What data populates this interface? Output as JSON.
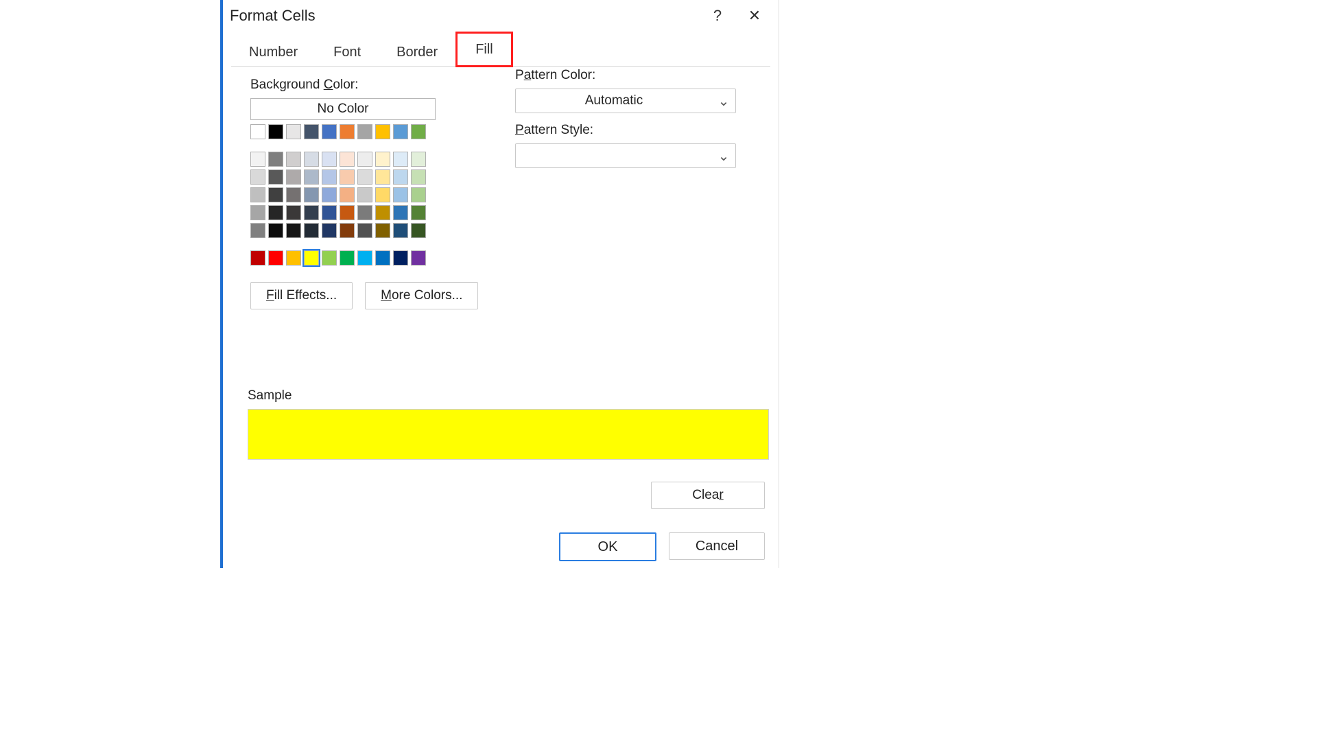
{
  "dialog": {
    "title": "Format Cells",
    "help_glyph": "?",
    "close_glyph": "✕"
  },
  "tabs": {
    "number": "Number",
    "font": "Font",
    "border": "Border",
    "fill": "Fill",
    "active": "fill"
  },
  "fill": {
    "background_label_pre": "Background ",
    "background_label_u": "C",
    "background_label_post": "olor:",
    "no_color": "No Color",
    "fill_effects_u": "F",
    "fill_effects_post": "ill Effects...",
    "more_colors_u": "M",
    "more_colors_post": "ore Colors...",
    "selected_color": "#ffff00",
    "theme_rows": [
      [
        "#ffffff",
        "#000000",
        "#e7e6e6",
        "#44546a",
        "#4472c4",
        "#ed7d31",
        "#a5a5a5",
        "#ffc000",
        "#5b9bd5",
        "#70ad47"
      ],
      [
        "#f2f2f2",
        "#7f7f7f",
        "#d0cece",
        "#d6dce5",
        "#d9e1f2",
        "#fce4d6",
        "#ededed",
        "#fff2cc",
        "#ddebf7",
        "#e2efda"
      ],
      [
        "#d9d9d9",
        "#595959",
        "#aeaaaa",
        "#acb9ca",
        "#b4c6e7",
        "#f8cbad",
        "#dbdbdb",
        "#ffe699",
        "#bdd7ee",
        "#c6e0b4"
      ],
      [
        "#bfbfbf",
        "#404040",
        "#757171",
        "#8497b0",
        "#8ea9db",
        "#f4b084",
        "#c9c9c9",
        "#ffd966",
        "#9bc2e6",
        "#a9d08e"
      ],
      [
        "#a6a6a6",
        "#262626",
        "#3a3838",
        "#333f4f",
        "#305496",
        "#c65911",
        "#7b7b7b",
        "#bf8f00",
        "#2e75b6",
        "#548235"
      ],
      [
        "#808080",
        "#0d0d0d",
        "#161616",
        "#222b35",
        "#203764",
        "#833c0c",
        "#525252",
        "#806000",
        "#1f4e78",
        "#375623"
      ]
    ],
    "standard_row": [
      "#c00000",
      "#ff0000",
      "#ffc000",
      "#ffff00",
      "#92d050",
      "#00b050",
      "#00b0f0",
      "#0070c0",
      "#002060",
      "#7030a0"
    ]
  },
  "pattern": {
    "color_label_pre": "P",
    "color_label_u": "a",
    "color_label_post": "ttern Color:",
    "color_value": "Automatic",
    "style_label_u": "P",
    "style_label_post": "attern Style:",
    "style_value": ""
  },
  "sample": {
    "label": "Sample",
    "color": "#ffff00"
  },
  "footer": {
    "clear_pre": "Clea",
    "clear_u": "r",
    "ok": "OK",
    "cancel": "Cancel"
  }
}
